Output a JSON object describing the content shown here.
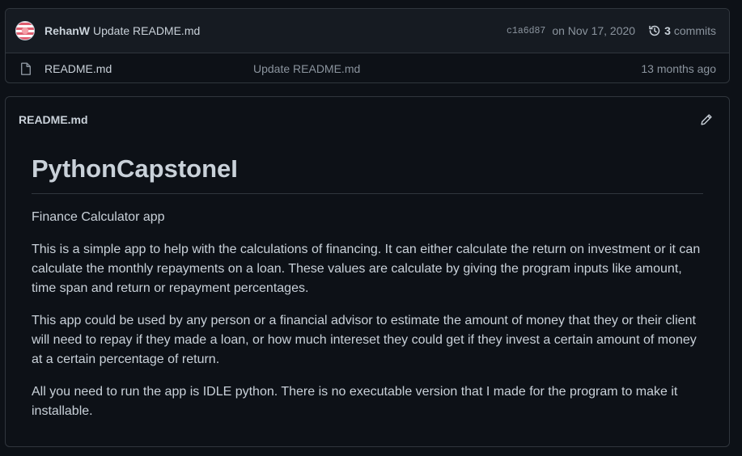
{
  "commit": {
    "author": "RehanW",
    "message": "Update README.md",
    "sha": "c1a6d87",
    "date": "on Nov 17, 2020",
    "count": "3",
    "count_label": "commits"
  },
  "file": {
    "name": "README.md",
    "last_commit": "Update README.md",
    "age": "13 months ago"
  },
  "readme": {
    "file_label": "README.md",
    "heading": "PythonCapstoneI",
    "paragraphs": [
      "Finance Calculator app",
      "This is a simple app to help with the calculations of financing. It can either calculate the return on investment or it can calculate the monthly repayments on a loan. These values are calculate by giving the program inputs like amount, time span and return or repayment percentages.",
      "This app could be used by any person or a financial advisor to estimate the amount of money that they or their client will need to repay if they made a loan, or how much intereset they could get if they invest a certain amount of money at a certain percentage of return.",
      "All you need to run the app is IDLE python. There is no executable version that I made for the program to make it installable."
    ]
  },
  "icons": {
    "avatar": "avatar",
    "history": "history-icon",
    "file": "file-icon",
    "edit": "pencil-icon"
  }
}
